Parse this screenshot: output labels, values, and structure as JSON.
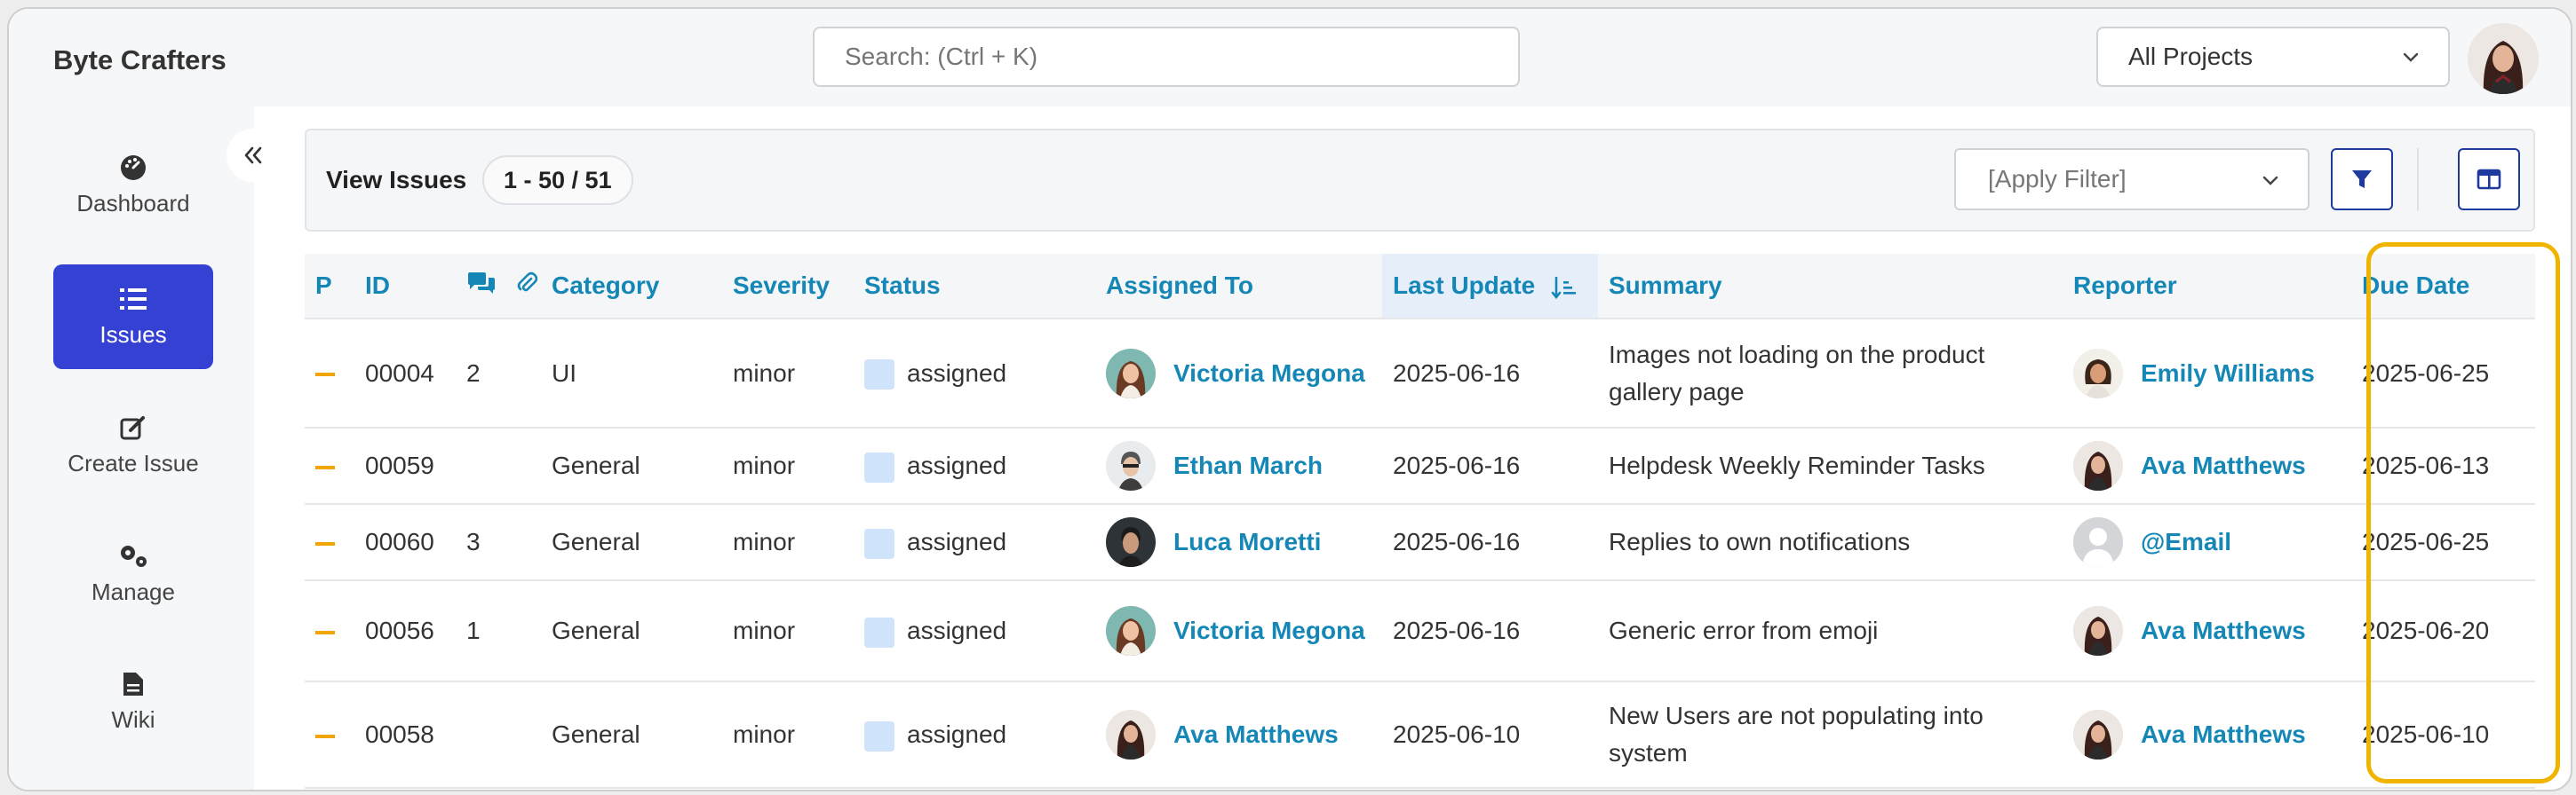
{
  "app": {
    "brand": "Byte Crafters"
  },
  "search": {
    "placeholder": "Search: (Ctrl + K)"
  },
  "project_select": {
    "value": "All Projects"
  },
  "sidebar": {
    "items": [
      {
        "label": "Dashboard",
        "icon": "dashboard-icon"
      },
      {
        "label": "Issues",
        "icon": "list-icon",
        "active": true
      },
      {
        "label": "Create Issue",
        "icon": "edit-icon"
      },
      {
        "label": "Manage",
        "icon": "gears-icon"
      },
      {
        "label": "Wiki",
        "icon": "document-icon"
      }
    ]
  },
  "panel": {
    "title": "View Issues",
    "count": "1 - 50 / 51",
    "filter_placeholder": "[Apply Filter]"
  },
  "table": {
    "headers": {
      "p": "P",
      "id": "ID",
      "category": "Category",
      "severity": "Severity",
      "status": "Status",
      "assigned": "Assigned To",
      "last_update": "Last Update",
      "summary": "Summary",
      "reporter": "Reporter",
      "due": "Due Date"
    },
    "rows": [
      {
        "id": "00004",
        "notes": "2",
        "category": "UI",
        "severity": "minor",
        "status": "assigned",
        "assigned": "Victoria Megona",
        "updated": "2025-06-16",
        "summary": "Images not loading on the product gallery page",
        "reporter": "Emily Williams",
        "due": "2025-06-25"
      },
      {
        "id": "00059",
        "notes": "",
        "category": "General",
        "severity": "minor",
        "status": "assigned",
        "assigned": "Ethan March",
        "updated": "2025-06-16",
        "summary": "Helpdesk Weekly Reminder Tasks",
        "reporter": "Ava Matthews",
        "due": "2025-06-13"
      },
      {
        "id": "00060",
        "notes": "3",
        "category": "General",
        "severity": "minor",
        "status": "assigned",
        "assigned": "Luca Moretti",
        "updated": "2025-06-16",
        "summary": "Replies to own notifications",
        "reporter": "@Email",
        "due": "2025-06-25"
      },
      {
        "id": "00056",
        "notes": "1",
        "category": "General",
        "severity": "minor",
        "status": "assigned",
        "assigned": "Victoria Megona",
        "updated": "2025-06-16",
        "summary": "Generic error from emoji",
        "reporter": "Ava Matthews",
        "due": "2025-06-20"
      },
      {
        "id": "00058",
        "notes": "",
        "category": "General",
        "severity": "minor",
        "status": "assigned",
        "assigned": "Ava Matthews",
        "updated": "2025-06-10",
        "summary": "New Users are not populating into system",
        "reporter": "Ava Matthews",
        "due": "2025-06-10"
      }
    ]
  },
  "colors": {
    "accent": "#3541d3",
    "link": "#1587b7",
    "due_overdue": "#d61c1c",
    "due_soon": "#f08a00",
    "priority": "#f0a500",
    "highlight": "#f0b400"
  }
}
